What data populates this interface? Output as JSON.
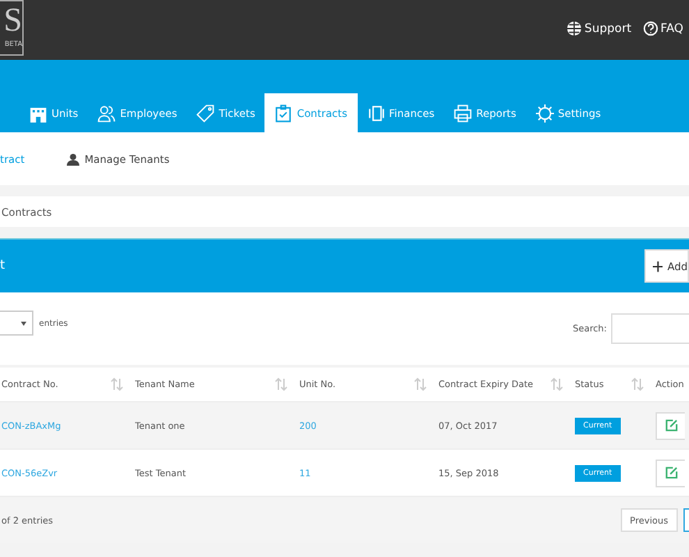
{
  "logo": {
    "letter": "S",
    "badge": "BETA"
  },
  "top_links": [
    {
      "label": "Support"
    },
    {
      "label": "FAQ"
    }
  ],
  "tabs": [
    {
      "label": "Units",
      "selected": false
    },
    {
      "label": "Employees",
      "selected": false
    },
    {
      "label": "Tickets",
      "selected": false
    },
    {
      "label": "Contracts",
      "selected": true
    },
    {
      "label": "Finances",
      "selected": false
    },
    {
      "label": "Reports",
      "selected": false
    },
    {
      "label": "Settings",
      "selected": false
    }
  ],
  "subnav": [
    {
      "label": "tract",
      "selected": true
    },
    {
      "label": "Manage Tenants",
      "selected": false
    }
  ],
  "breadcrumb": "Contracts",
  "panel": {
    "title": "t",
    "add_button": "Add"
  },
  "length": {
    "label": "entries"
  },
  "search": {
    "label": "Search:"
  },
  "table": {
    "columns": [
      "Contract No.",
      "Tenant Name",
      "Unit No.",
      "Contract Expiry Date",
      "Status",
      "Action"
    ],
    "rows": [
      {
        "contract": "CON-zBAxMg",
        "tenant": "Tenant one",
        "unit": "200",
        "expiry": "07, Oct 2017",
        "status": "Current"
      },
      {
        "contract": "CON-56eZvr",
        "tenant": "Test Tenant",
        "unit": "11",
        "expiry": "15, Sep 2018",
        "status": "Current"
      }
    ]
  },
  "footer": {
    "info": "of 2 entries",
    "previous": "Previous"
  }
}
